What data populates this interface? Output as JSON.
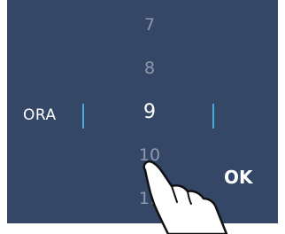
{
  "picker": {
    "label": "ORA",
    "items": [
      "7",
      "8",
      "9",
      "10",
      "11"
    ],
    "selected": "9"
  },
  "actions": {
    "ok_label": "OK"
  },
  "colors": {
    "screen_bg": "#344766",
    "accent_divider": "#4aa9d8",
    "text_primary": "#ffffff",
    "text_dim": "#8e98aa"
  },
  "icons": {
    "pointer": "hand-pointer-icon"
  }
}
